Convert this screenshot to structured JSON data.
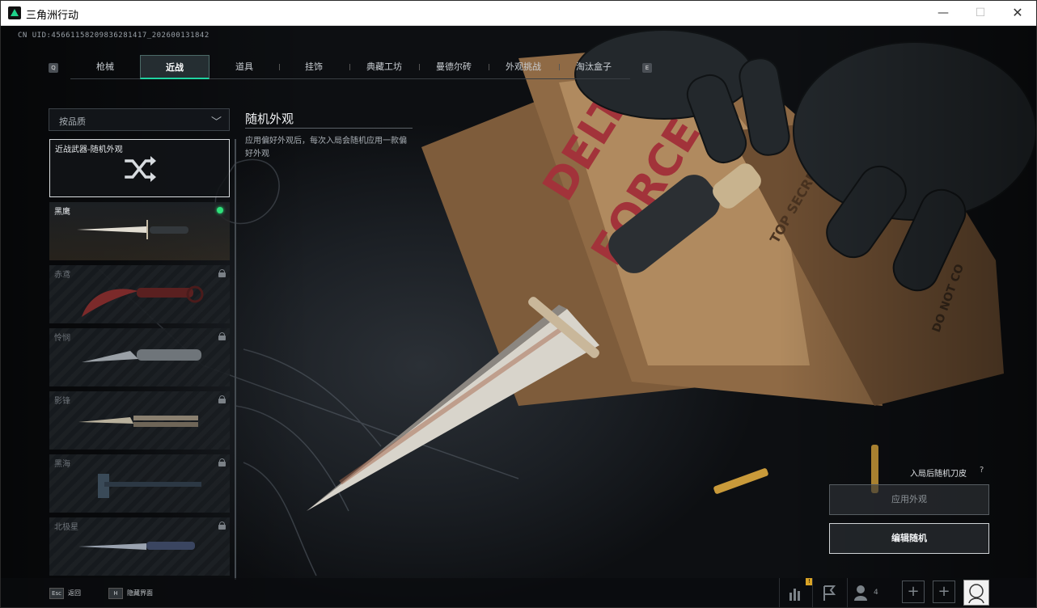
{
  "window": {
    "title": "三角洲行动",
    "minimize": "—",
    "maximize": "☐",
    "close": "✕"
  },
  "uid": "CN UID:45661158209836281417_202600131842",
  "tabs": {
    "left_key": "Q",
    "right_key": "E",
    "items": [
      {
        "label": "枪械",
        "active": false
      },
      {
        "label": "近战",
        "active": true
      },
      {
        "label": "道具",
        "active": false
      },
      {
        "label": "挂饰",
        "active": false
      },
      {
        "label": "典藏工坊",
        "active": false
      },
      {
        "label": "曼德尔砖",
        "active": false
      },
      {
        "label": "外观挑战",
        "active": false
      },
      {
        "label": "淘汰盒子",
        "active": false
      }
    ]
  },
  "filter": {
    "label": "按品质",
    "chevron": "chevron-down"
  },
  "list": {
    "random_item": {
      "label": "近战武器-随机外观",
      "icon": "shuffle-icon"
    },
    "items": [
      {
        "name": "黑鹰",
        "locked": false,
        "equipped": true
      },
      {
        "name": "赤鸢",
        "locked": true,
        "equipped": false
      },
      {
        "name": "怜悯",
        "locked": true,
        "equipped": false
      },
      {
        "name": "影锋",
        "locked": true,
        "equipped": false
      },
      {
        "name": "黑海",
        "locked": true,
        "equipped": false
      },
      {
        "name": "北极星",
        "locked": true,
        "equipped": false
      }
    ]
  },
  "info": {
    "title": "随机外观",
    "description": "应用偏好外观后，每次入局会随机应用一款偏好外观"
  },
  "actions": {
    "random_label": "入局后随机刀皮",
    "help": "?",
    "apply": "应用外观",
    "edit": "编辑随机"
  },
  "bottom": {
    "hints": [
      {
        "key": "Esc",
        "label": "返回"
      },
      {
        "key": "H",
        "label": "隐藏界面"
      }
    ],
    "friends_count": "4",
    "notification_badge": "!"
  },
  "colors": {
    "accent": "#1fd3a0",
    "equipped_dot": "#2ee07a"
  }
}
